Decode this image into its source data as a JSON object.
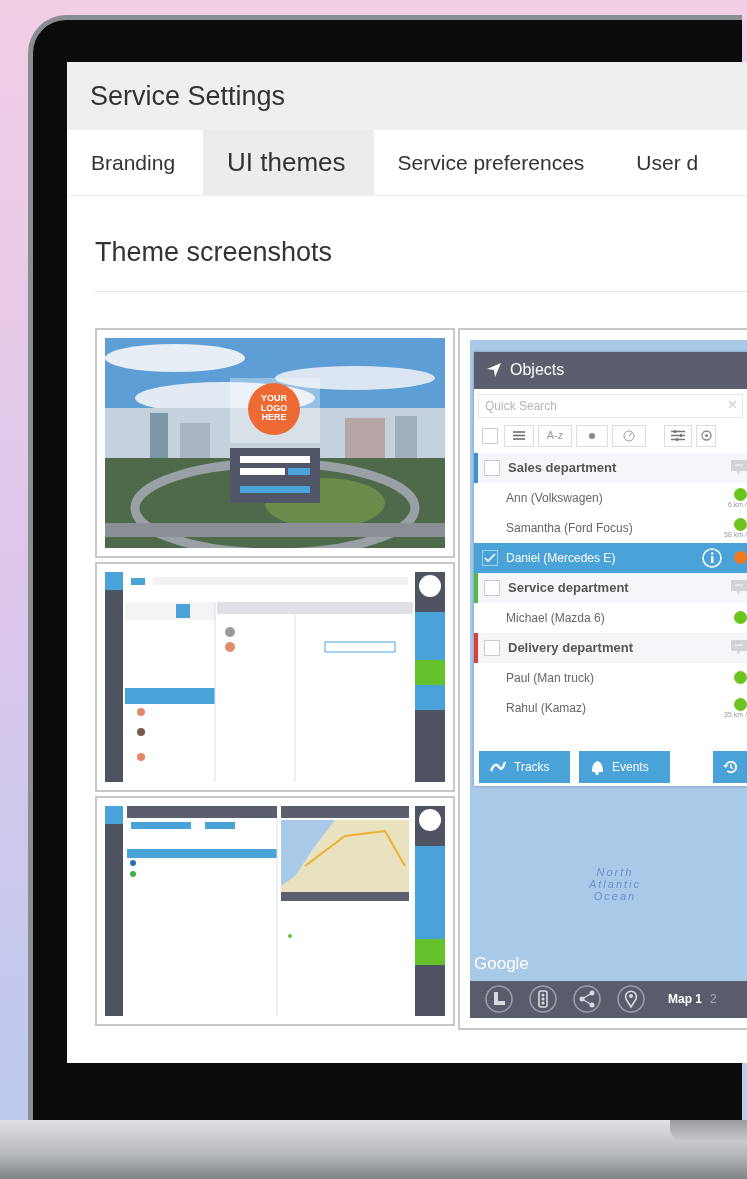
{
  "header": {
    "title": "Service Settings"
  },
  "tabs": [
    {
      "label": "Branding",
      "selected": false
    },
    {
      "label": "UI themes",
      "selected": true
    },
    {
      "label": "Service preferences",
      "selected": false
    },
    {
      "label": "User d",
      "selected": false
    }
  ],
  "section": {
    "title": "Theme screenshots"
  },
  "thumbnails": [
    {
      "kind": "login",
      "logo_text": "YOUR LOGO HERE"
    },
    {
      "kind": "tasks"
    },
    {
      "kind": "vehicles"
    }
  ],
  "preview": {
    "panel_title": "Objects",
    "search": {
      "placeholder": "Quick Search"
    },
    "sort_label": "A-z",
    "select_all_checked": false,
    "groups": [
      {
        "name": "Sales department",
        "color": "#3d8fd1",
        "checked": false,
        "items": [
          {
            "name": "Ann (Volkswagen)",
            "color": "#6cc421",
            "speed": "6 km /",
            "selected": false
          },
          {
            "name": "Samantha (Ford Focus)",
            "color": "#6cc421",
            "speed": "58 km /",
            "selected": false
          },
          {
            "name": "Daniel (Mercedes E)",
            "color": "#f07a1e",
            "selected": true
          }
        ]
      },
      {
        "name": "Service department",
        "color": "#55b948",
        "checked": false,
        "items": [
          {
            "name": "Michael (Mazda 6)",
            "color": "#6cc421",
            "selected": false
          }
        ]
      },
      {
        "name": "Delivery department",
        "color": "#d94040",
        "checked": false,
        "items": [
          {
            "name": "Paul (Man truck)",
            "color": "#6cc421",
            "selected": false
          },
          {
            "name": "Rahul (Kamaz)",
            "color": "#6cc421",
            "speed": "35 km /",
            "selected": false
          }
        ]
      }
    ],
    "buttons": [
      {
        "kind": "tracks",
        "label": "Tracks"
      },
      {
        "kind": "events",
        "label": "Events"
      },
      {
        "kind": "history"
      }
    ],
    "map": {
      "label": "North Atlantic Ocean",
      "attribution": "Google"
    },
    "map_tabs": [
      {
        "label": "Map 1",
        "selected": true
      },
      {
        "label": "2",
        "selected": false
      }
    ]
  }
}
